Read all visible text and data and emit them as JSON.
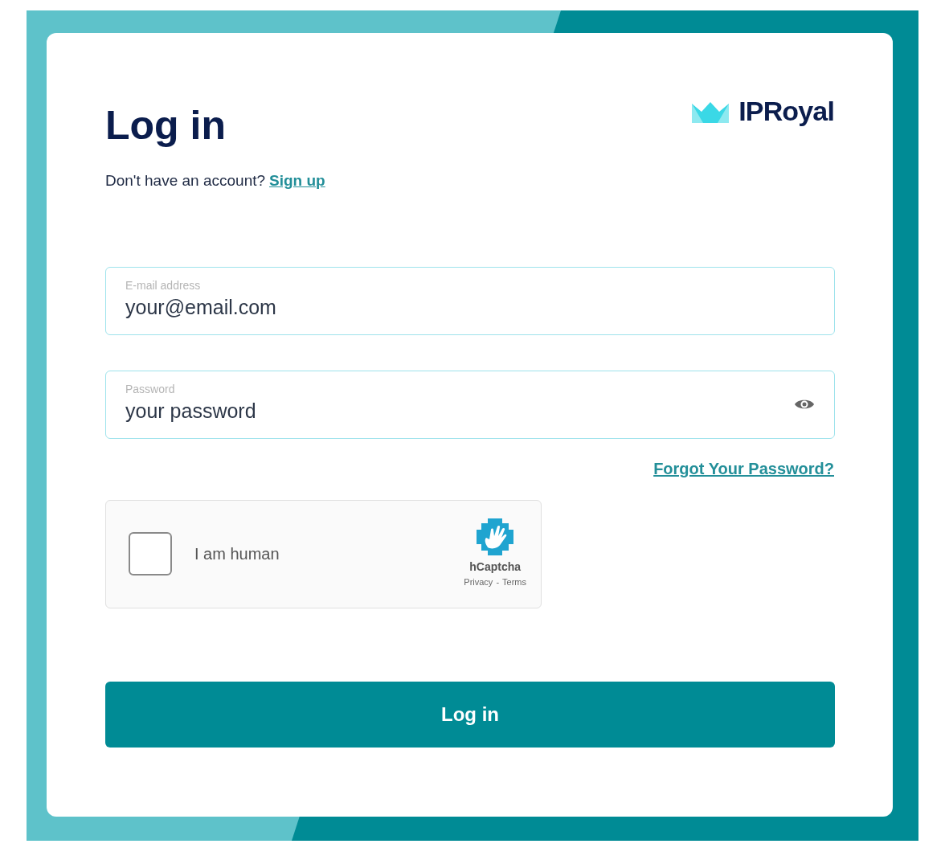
{
  "logo": {
    "text": "IPRoyal"
  },
  "title": "Log in",
  "signup": {
    "prompt": "Don't have an account?",
    "link": "Sign up"
  },
  "fields": [
    {
      "label": "E-mail address",
      "placeholder": "your@email.com",
      "kind": "email"
    },
    {
      "label": "Password",
      "placeholder": "your password",
      "kind": "password"
    }
  ],
  "forgot_link": "Forgot Your Password?",
  "captcha": {
    "label": "I am human",
    "checked": false,
    "brand": "hCaptcha",
    "privacy": "Privacy",
    "separator": "-",
    "terms": "Terms"
  },
  "submit": "Log in"
}
